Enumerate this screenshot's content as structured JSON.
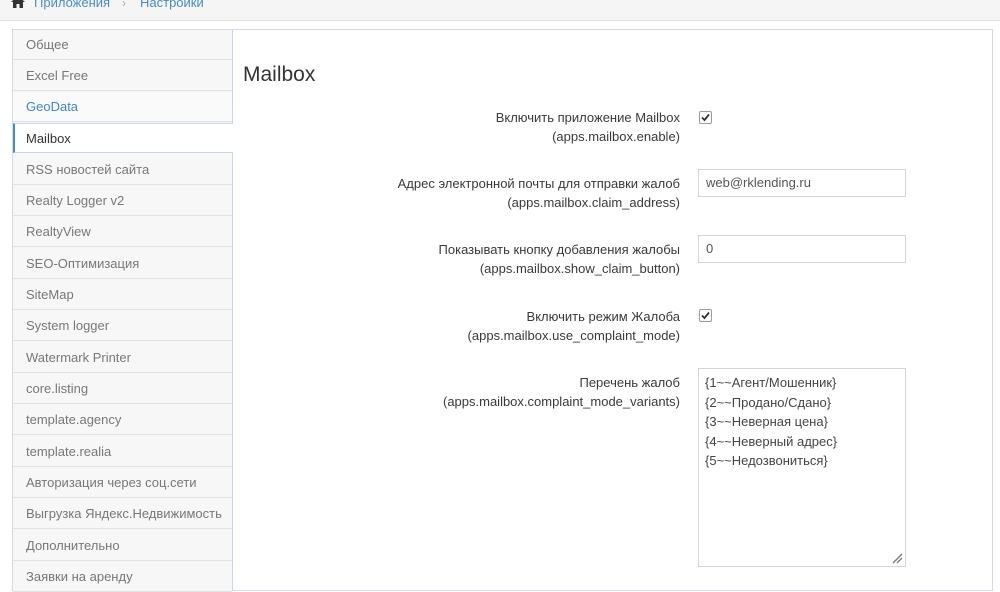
{
  "breadcrumb": {
    "items": [
      "Приложения",
      "Настройки"
    ],
    "separator": "›",
    "home_icon": "home-icon"
  },
  "sidebar": {
    "items": [
      {
        "label": "Общее",
        "state": "normal"
      },
      {
        "label": "Excel Free",
        "state": "normal"
      },
      {
        "label": "GeoData",
        "state": "hover"
      },
      {
        "label": "Mailbox",
        "state": "active"
      },
      {
        "label": "RSS новостей сайта",
        "state": "normal"
      },
      {
        "label": "Realty Logger v2",
        "state": "normal"
      },
      {
        "label": "RealtyView",
        "state": "normal"
      },
      {
        "label": "SEO-Оптимизация",
        "state": "normal"
      },
      {
        "label": "SiteMap",
        "state": "normal"
      },
      {
        "label": "System logger",
        "state": "normal"
      },
      {
        "label": "Watermark Printer",
        "state": "normal"
      },
      {
        "label": "core.listing",
        "state": "normal"
      },
      {
        "label": "template.agency",
        "state": "normal"
      },
      {
        "label": "template.realia",
        "state": "normal"
      },
      {
        "label": "Авторизация через соц.сети",
        "state": "normal"
      },
      {
        "label": "Выгрузка Яндекс.Недвижимость",
        "state": "normal"
      },
      {
        "label": "Дополнительно",
        "state": "normal"
      },
      {
        "label": "Заявки на аренду",
        "state": "normal"
      }
    ]
  },
  "main": {
    "title": "Mailbox",
    "settings": [
      {
        "label": "Включить приложение Mailbox",
        "key": "(apps.mailbox.enable)",
        "type": "checkbox",
        "checked": true
      },
      {
        "label": "Адрес электронной почты для отправки жалоб",
        "key": "(apps.mailbox.claim_address)",
        "type": "text",
        "value": "web@rklending.ru"
      },
      {
        "label": "Показывать кнопку добавления жалобы",
        "key": "(apps.mailbox.show_claim_button)",
        "type": "text",
        "value": "0"
      },
      {
        "label": "Включить режим Жалоба",
        "key": "(apps.mailbox.use_complaint_mode)",
        "type": "checkbox",
        "checked": true
      },
      {
        "label": "Перечень жалоб",
        "key": "(apps.mailbox.complaint_mode_variants)",
        "type": "textarea",
        "lines": [
          "{1~~Агент/Мошенник}",
          "{2~~Продано/Сдано}",
          "{3~~Неверная цена}",
          "{4~~Неверный адрес}",
          "{5~~Недозвониться}"
        ]
      }
    ]
  },
  "colors": {
    "link": "#4a8bc4",
    "active_border": "#4a8bc4",
    "sidebar_bg": "#f7f7f7"
  }
}
